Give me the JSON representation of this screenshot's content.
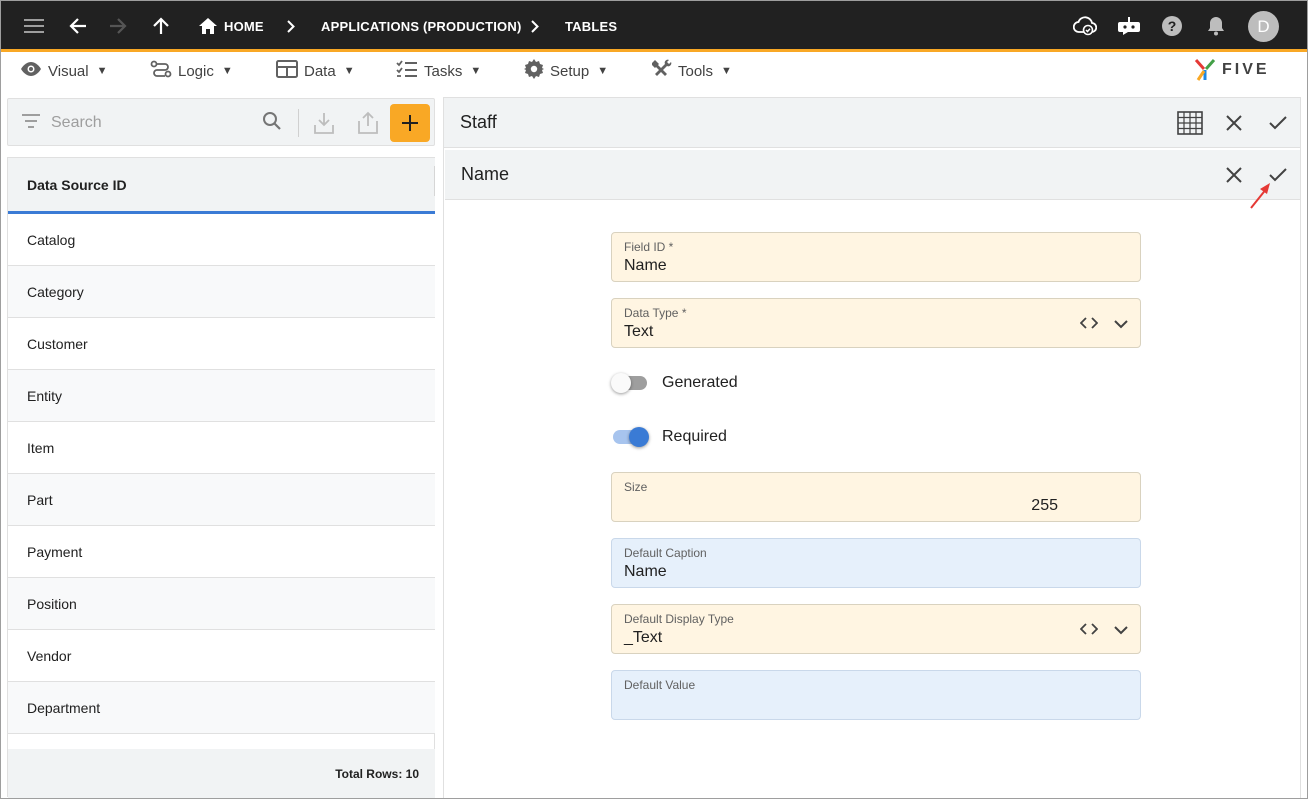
{
  "topbar": {
    "breadcrumbs": [
      "HOME",
      "APPLICATIONS (PRODUCTION)",
      "TABLES"
    ],
    "avatar_initial": "D",
    "icons": [
      "menu-icon",
      "back-arrow-icon",
      "forward-arrow-icon",
      "up-arrow-icon",
      "home-icon",
      "chevron-right-icon",
      "cloud-check-icon",
      "chat-bot-icon",
      "help-icon",
      "bell-icon"
    ]
  },
  "menubar": {
    "items": [
      {
        "label": "Visual",
        "icon": "eye-icon"
      },
      {
        "label": "Logic",
        "icon": "logic-flow-icon"
      },
      {
        "label": "Data",
        "icon": "table-grid-icon"
      },
      {
        "label": "Tasks",
        "icon": "checklist-icon"
      },
      {
        "label": "Setup",
        "icon": "gear-icon"
      },
      {
        "label": "Tools",
        "icon": "tools-icon"
      }
    ],
    "logo_text": "FIVE"
  },
  "search": {
    "placeholder": "Search"
  },
  "list": {
    "header": "Data Source ID",
    "rows": [
      "Catalog",
      "Category",
      "Customer",
      "Entity",
      "Item",
      "Part",
      "Payment",
      "Position",
      "Vendor",
      "Department"
    ],
    "footer": "Total Rows: 10"
  },
  "form": {
    "title": "Staff",
    "subtitle": "Name",
    "fields": {
      "field_id": {
        "label": "Field ID *",
        "value": "Name"
      },
      "data_type": {
        "label": "Data Type *",
        "value": "Text"
      },
      "generated": {
        "label": "Generated",
        "on": false
      },
      "required": {
        "label": "Required",
        "on": true
      },
      "size": {
        "label": "Size",
        "value": "255"
      },
      "default_caption": {
        "label": "Default Caption",
        "value": "Name"
      },
      "default_display_type": {
        "label": "Default Display Type",
        "value": "_Text"
      },
      "default_value": {
        "label": "Default Value",
        "value": ""
      }
    }
  },
  "colors": {
    "topbar_bg": "#212121",
    "accent": "#f9a825",
    "highlight_blue": "#3a7bd5",
    "field_yellow": "#fff5e2",
    "field_blue": "#e6f0fb",
    "annotation_arrow": "#e53935"
  }
}
